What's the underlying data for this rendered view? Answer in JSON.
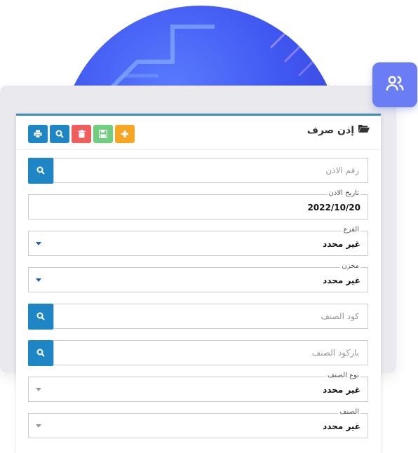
{
  "form": {
    "title": "إذن صرف",
    "permit_number_placeholder": "رقم الاذن",
    "permit_date_label": "تاريخ الاذن",
    "permit_date_value": "2022/10/20",
    "branch_label": "الفرع",
    "branch_value": "غير محدد",
    "store_label": "مخزن",
    "store_value": "غير محدد",
    "item_code_placeholder": "كود الصنف",
    "item_barcode_placeholder": "باركود الصنف",
    "item_type_label": "نوع الصنف",
    "item_type_value": "غير محدد",
    "item_label": "الصنف",
    "item_value": "غير محدد"
  },
  "colors": {
    "primary": "#1f86c5",
    "danger": "#f05d5d",
    "success": "#6fcf7c",
    "warning": "#f5a623",
    "accent": "#6b7df5"
  },
  "icons": [
    "print-icon",
    "search-icon",
    "trash-icon",
    "save-icon",
    "plus-icon",
    "folder-open-icon",
    "users-icon"
  ]
}
